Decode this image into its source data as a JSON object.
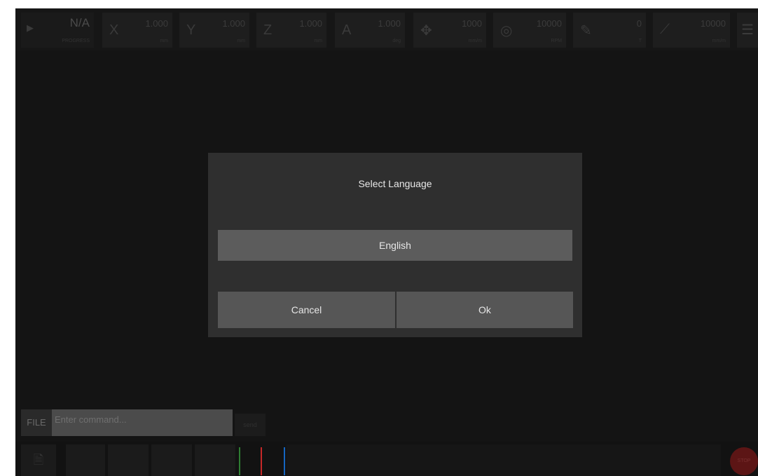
{
  "topbar": {
    "state": {
      "value": "N/A",
      "label": "PROGRESS",
      "icon": "play-icon"
    },
    "axes": [
      {
        "name": "X",
        "value": "1.000",
        "unit": "mm"
      },
      {
        "name": "Y",
        "value": "1.000",
        "unit": "mm"
      },
      {
        "name": "Z",
        "value": "1.000",
        "unit": "mm"
      },
      {
        "name": "A",
        "value": "1.000",
        "unit": "deg"
      }
    ],
    "feed": {
      "icon": "move-arrows-icon",
      "value": "1000",
      "unit": "mm/m"
    },
    "spindle": {
      "icon": "spindle-icon",
      "value": "10000",
      "unit": "RPM"
    },
    "tool": {
      "icon": "tool-edit-icon",
      "value": "0",
      "unit": "T"
    },
    "rate": {
      "icon": "diagonal-line-icon",
      "value": "10000",
      "unit": "mm/m"
    },
    "menu_icon": "menu-icon"
  },
  "dialog": {
    "title": "Select Language",
    "language_value": "English",
    "cancel_label": "Cancel",
    "ok_label": "Ok"
  },
  "command": {
    "file_label": "FILE",
    "placeholder": "Enter command...",
    "send_label": "send"
  },
  "bottombar": {
    "file_icon": "file-icon",
    "buttons": [
      "",
      "",
      "",
      ""
    ],
    "stop_label": "STOP",
    "line_colors": [
      "#2e7d32",
      "#c62828",
      "#1565c0"
    ]
  }
}
